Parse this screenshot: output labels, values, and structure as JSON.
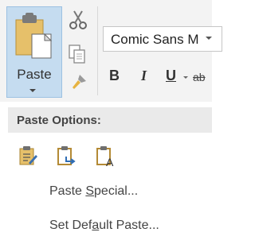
{
  "ribbon": {
    "paste_label": "Paste",
    "font_name": "Comic Sans M",
    "bold_label": "B",
    "italic_label": "I",
    "underline_label": "U",
    "strike_label": "ab",
    "icons": {
      "paste": "clipboard-paste-icon",
      "cut": "scissors-icon",
      "copy": "copy-icon",
      "format_painter": "format-painter-icon"
    }
  },
  "menu": {
    "header": "Paste Options:",
    "options": [
      {
        "icon": "keep-source-formatting-icon"
      },
      {
        "icon": "merge-formatting-icon"
      },
      {
        "icon": "keep-text-only-icon"
      }
    ],
    "items": [
      {
        "pre": "Paste ",
        "accel": "S",
        "post": "pecial..."
      },
      {
        "pre": "Set Def",
        "accel": "a",
        "post": "ult Paste..."
      }
    ]
  },
  "colors": {
    "paste_button_bg": "#c5dcf0",
    "ribbon_bg": "#f3f3f3",
    "menu_header_bg": "#eaeaea",
    "clipboard_gold": "#e6c06a"
  }
}
